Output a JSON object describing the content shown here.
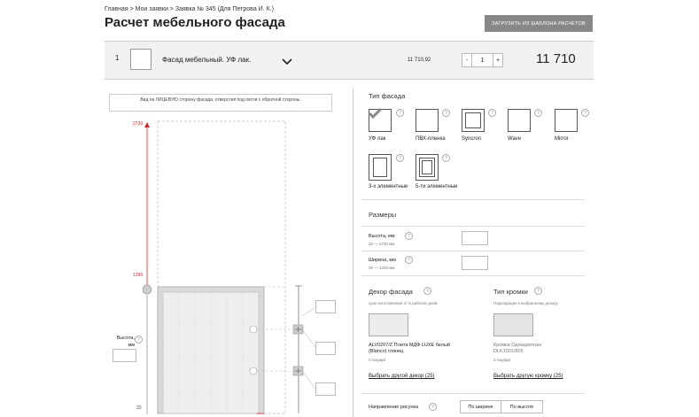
{
  "breadcrumb": {
    "text": "Главная > Мои заявки > Заявка № 345 (Для Петрова И. К.)"
  },
  "page_title": "Расчет мебельного фасада",
  "header": {
    "template_button": "ЗАГРУЗИТЬ ИЗ ШАБЛОНА РАСЧЕТОВ"
  },
  "order_row": {
    "number": "1",
    "name": "Фасад  мебельный. УФ лак.",
    "unit_price": "11 710,92",
    "qty_minus": "-",
    "quantity": "1",
    "qty_plus": "+",
    "total": "11 710"
  },
  "preview": {
    "note": "Вид на ЛИЦЕВУЮ сторону фасада, отверстия под петли с обратной стороны.",
    "dim_top": "2730",
    "dim_mid": "1296",
    "dim_bottom": "20",
    "height_label": "Высота, мм",
    "help": "?"
  },
  "facade_type": {
    "title": "Тип фасада",
    "options": [
      {
        "label": "УФ лак",
        "selected": true
      },
      {
        "label": "ПВХ-пленка",
        "selected": false
      },
      {
        "label": "Syncron",
        "selected": false
      },
      {
        "label": "Wave",
        "selected": false
      },
      {
        "label": "Mirror",
        "selected": false
      },
      {
        "label": "3-х элементные",
        "selected": false
      },
      {
        "label": "5-ти элементные",
        "selected": false
      }
    ]
  },
  "sizes": {
    "title": "Размеры",
    "height_label": "Высота, мм",
    "height_range": "20 — 2730 мм",
    "width_label": "Ширина, мм",
    "width_range": "20 — 1200 мм"
  },
  "decor": {
    "title": "Декор фасада",
    "note": "срок изготовления от 5 рабочих дней",
    "name_line1": "ALV0207/Z Плита МДФ LUXE белый",
    "name_line2": "(Blanco) глянец",
    "category": "Стандарт",
    "link": "Выбрать другой декор (25)"
  },
  "edge": {
    "title": "Тип кромки",
    "note": "Подходящие к выбранному декору",
    "name_line1": "Кромка Однацветная",
    "name_line2": "DLK1001/805",
    "category": "Стандарт",
    "link": "Выбрать другую кромку (25)"
  },
  "pattern": {
    "label": "Направление рисунка",
    "by_width": "По ширине",
    "by_height": "По высоте"
  },
  "colors": {
    "accent_red": "#e02020",
    "button_gray": "#888888"
  }
}
